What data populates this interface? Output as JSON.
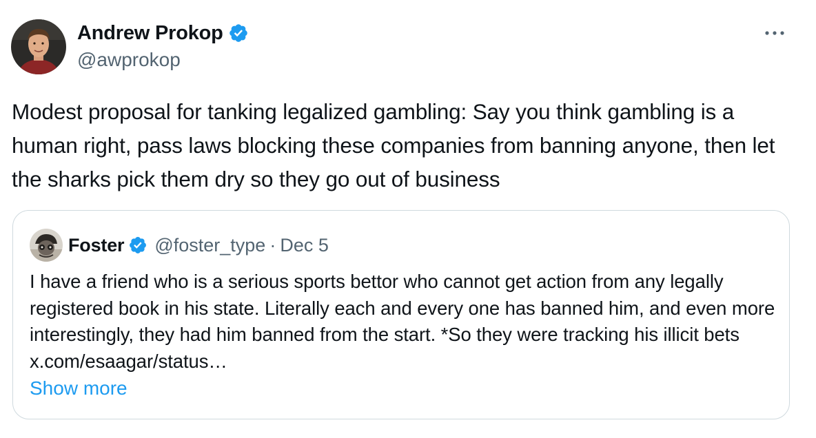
{
  "author": {
    "display_name": "Andrew Prokop",
    "handle": "@awprokop",
    "verified": true,
    "avatar_icon": "user-avatar"
  },
  "menu": {
    "icon": "more-horizontal-icon"
  },
  "tweet": {
    "text": "Modest proposal for tanking legalized gambling: Say you think gambling is a human right, pass laws blocking these companies from banning anyone, then let the sharks pick them dry so they go out of business"
  },
  "quoted": {
    "display_name": "Foster",
    "handle": "@foster_type",
    "separator": "·",
    "date": "Dec 5",
    "verified": true,
    "text": "I have a friend who is a serious sports bettor who cannot get action from any legally registered book in his state. Literally each and every one has banned him, and even more interestingly, they had him banned from the start. *So they were tracking his illicit bets x.com/esaagar/status…",
    "show_more": "Show more"
  },
  "colors": {
    "text": "#0f1419",
    "secondary": "#536471",
    "accent": "#1d9bf0",
    "border": "#cfd9de"
  }
}
